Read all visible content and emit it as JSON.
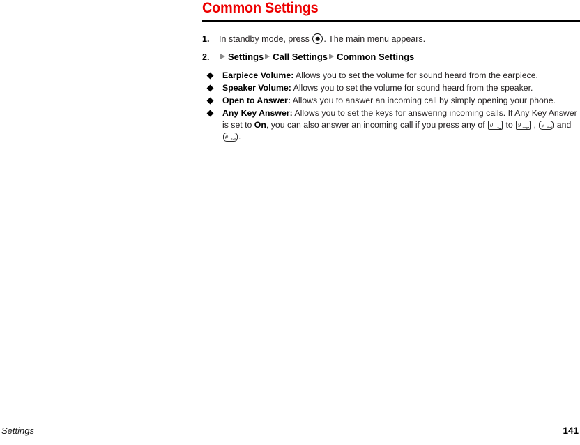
{
  "document": {
    "heading": "Common Settings",
    "heading_color": "#ED0000",
    "rule_color": "#000000"
  },
  "steps": [
    {
      "number": "1.",
      "text_before_icon": "In standby mode, press",
      "icon": "ok-select-key-icon",
      "text_after_icon": ". The main menu appears."
    },
    {
      "number": "2.",
      "breadcrumb": [
        {
          "arrow": "▶",
          "label": "Settings"
        },
        {
          "arrow": "▶",
          "label": "Call Settings"
        },
        {
          "arrow": "▶",
          "label": "Common Settings"
        }
      ]
    }
  ],
  "bullets": [
    {
      "bullet": "◆",
      "term": "Earpiece Volume:",
      "description": " Allows you to set the volume for sound heard from the earpiece."
    },
    {
      "bullet": "◆",
      "term": "Speaker Volume:",
      "description": " Allows you to set the volume for sound heard from the speaker."
    },
    {
      "bullet": "◆",
      "term": "Open to Answer:",
      "description": " Allows you to answer an incoming call by simply opening your phone."
    },
    {
      "bullet": "◆",
      "term": "Any Key Answer:",
      "description_part1": " Allows you to set the keys for answering incoming calls. If Any Key Answer is set to ",
      "emphasis": "On",
      "description_part2": ", you can also answer an incoming call if you press any of ",
      "key_sequence": {
        "key_0": {
          "main": "0",
          "sub": "+␣"
        },
        "connector_to": " to ",
        "key_9": {
          "main": "9",
          "sub": "wxyz"
        },
        "connector_comma": " , ",
        "key_star": {
          "main": "⁎",
          "sub": "Δα§"
        },
        "connector_and": " and ",
        "key_hash": {
          "main": "#",
          "sub": "©¤®"
        },
        "terminator": "."
      }
    }
  ],
  "footer": {
    "section": "Settings",
    "page_number": "141"
  }
}
